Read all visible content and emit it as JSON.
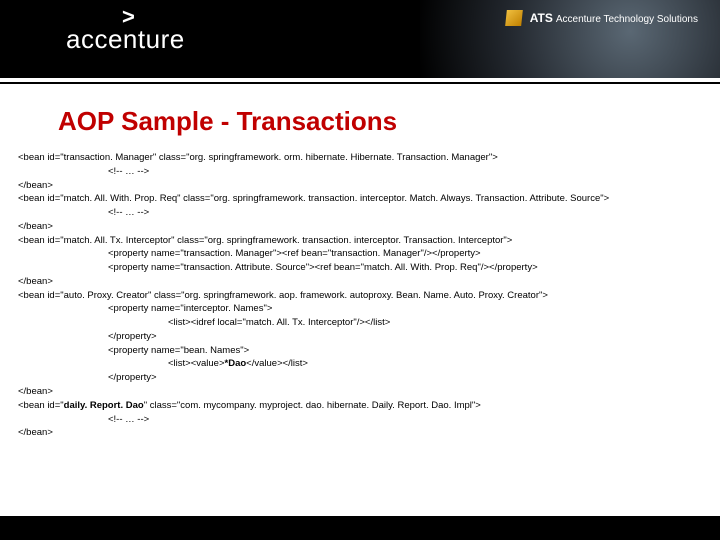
{
  "brand": {
    "caret": ">",
    "logo": "accenture",
    "ats_label": "ATS",
    "ats_sub": "Accenture Technology Solutions"
  },
  "title": "AOP Sample - Transactions",
  "code": {
    "l1": "<bean id=\"transaction. Manager\" class=\"org. springframework. orm. hibernate. Hibernate. Transaction. Manager\">",
    "l2": "<!-- … -->",
    "l3": "</bean>",
    "l4": "<bean id=\"match. All. With. Prop. Req\" class=\"org. springframework. transaction. interceptor. Match. Always. Transaction. Attribute. Source\">",
    "l5": "<!-- … -->",
    "l6": "</bean>",
    "l7": "<bean id=\"match. All. Tx. Interceptor\" class=\"org. springframework. transaction. interceptor. Transaction. Interceptor\">",
    "l8": "<property name=\"transaction. Manager\"><ref bean=\"transaction. Manager\"/></property>",
    "l9": "<property name=\"transaction. Attribute. Source\"><ref bean=\"match. All. With. Prop. Req\"/></property>",
    "l10": "</bean>",
    "l11": "<bean id=\"auto. Proxy. Creator\" class=\"org. springframework. aop. framework. autoproxy. Bean. Name. Auto. Proxy. Creator\">",
    "l12": "<property name=\"interceptor. Names\">",
    "l13": "<list><idref local=\"match. All. Tx. Interceptor\"/></list>",
    "l14": "</property>",
    "l15": "<property name=\"bean. Names\">",
    "l16_a": "<list><value>",
    "l16_b": "*Dao",
    "l16_c": "</value></list>",
    "l17": "</property>",
    "l18": "</bean>",
    "l19_a": "<bean id=\"",
    "l19_b": "daily. Report. Dao",
    "l19_c": "\" class=\"com. mycompany. myproject. dao. hibernate. Daily. Report. Dao. Impl\">",
    "l20": "<!-- … -->",
    "l21": "</bean>"
  }
}
